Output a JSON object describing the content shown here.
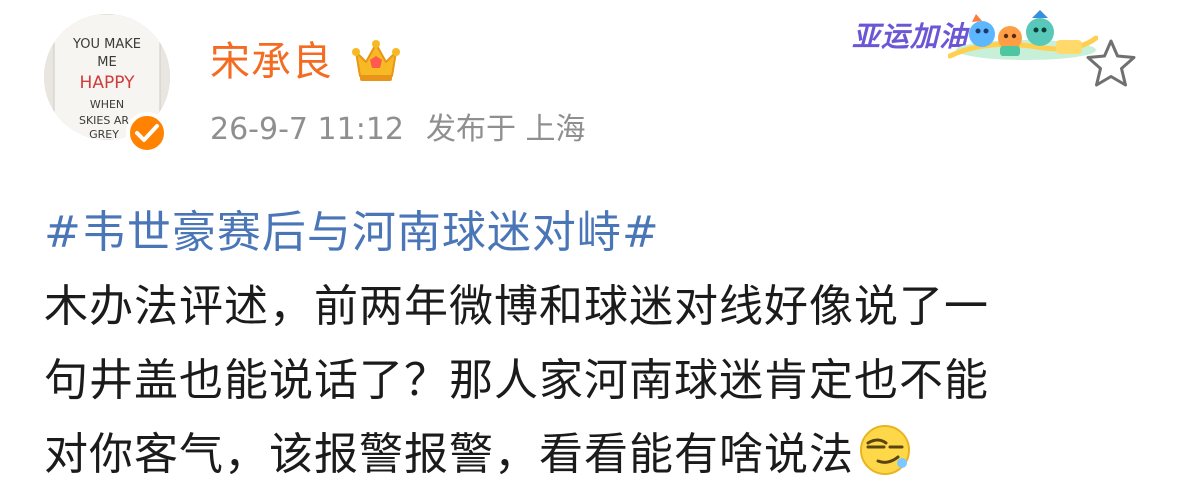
{
  "user": {
    "name": "宋承良",
    "avatar_text": [
      "YOU MAKE",
      "ME",
      "HAPPY",
      "WHEN",
      "SKIES AR",
      "GREY"
    ],
    "avatar_icon": "avatar",
    "verified_icon": "verified-check-icon",
    "crown_icon": "crown-icon"
  },
  "meta": {
    "timestamp": "26-9-7 11:12",
    "location": "发布于 上海"
  },
  "badge": {
    "text": "亚运加油",
    "icon": "asian-games-mascot-icon"
  },
  "actions": {
    "favorite_icon": "star-icon"
  },
  "post": {
    "hashtag": "#韦世豪赛后与河南球迷对峙#",
    "lines": [
      "木办法评述，前两年微博和球迷对线好像说了一",
      "句井盖也能说话了？那人家河南球迷肯定也不能",
      "对你客气，该报警报警，看看能有啥说法"
    ],
    "emoji": "smirk-emoji-icon"
  },
  "colors": {
    "username": "#f36c21",
    "hashtag": "#4a76b8",
    "meta": "#8f8f8f",
    "verified": "#ff8200",
    "badge_text": "#6b57d6"
  }
}
